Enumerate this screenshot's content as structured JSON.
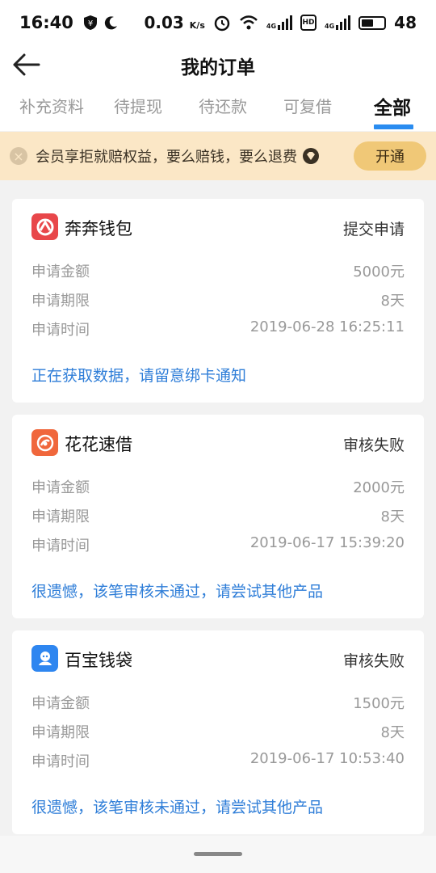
{
  "status_bar": {
    "time": "16:40",
    "net_speed": "0.03",
    "net_unit": "K/s",
    "signal_label_1": "4G",
    "hd_label": "HD",
    "signal_label_2": "4G",
    "battery": "48"
  },
  "header": {
    "title": "我的订单"
  },
  "tabs": [
    {
      "label": "补充资料",
      "active": false
    },
    {
      "label": "待提现",
      "active": false
    },
    {
      "label": "待还款",
      "active": false
    },
    {
      "label": "可复借",
      "active": false
    },
    {
      "label": "全部",
      "active": true
    }
  ],
  "banner": {
    "text": "会员享拒就赔权益，要么赔钱，要么退费",
    "button_label": "开通"
  },
  "orders": [
    {
      "app_name": "奔奔钱包",
      "status": "提交申请",
      "amount_label": "申请金额",
      "amount_value": "5000元",
      "term_label": "申请期限",
      "term_value": "8天",
      "time_label": "申请时间",
      "time_value": "2019-06-28 16:25:11",
      "note": "正在获取数据，请留意绑卡通知",
      "logo_color": "#e8474a"
    },
    {
      "app_name": "花花速借",
      "status": "审核失败",
      "amount_label": "申请金额",
      "amount_value": "2000元",
      "term_label": "申请期限",
      "term_value": "8天",
      "time_label": "申请时间",
      "time_value": "2019-06-17 15:39:20",
      "note": "很遗憾，该笔审核未通过，请尝试其他产品",
      "logo_color": "#f0673c"
    },
    {
      "app_name": "百宝钱袋",
      "status": "审核失败",
      "amount_label": "申请金额",
      "amount_value": "1500元",
      "term_label": "申请期限",
      "term_value": "8天",
      "time_label": "申请时间",
      "time_value": "2019-06-17 10:53:40",
      "note": "很遗憾，该笔审核未通过，请尝试其他产品",
      "logo_color": "#2e86f0"
    }
  ],
  "colors": {
    "accent": "#2a8cf0",
    "note_blue": "#2f7ed8",
    "banner_bg": "#fbe7c6",
    "banner_button": "#f0c877"
  }
}
